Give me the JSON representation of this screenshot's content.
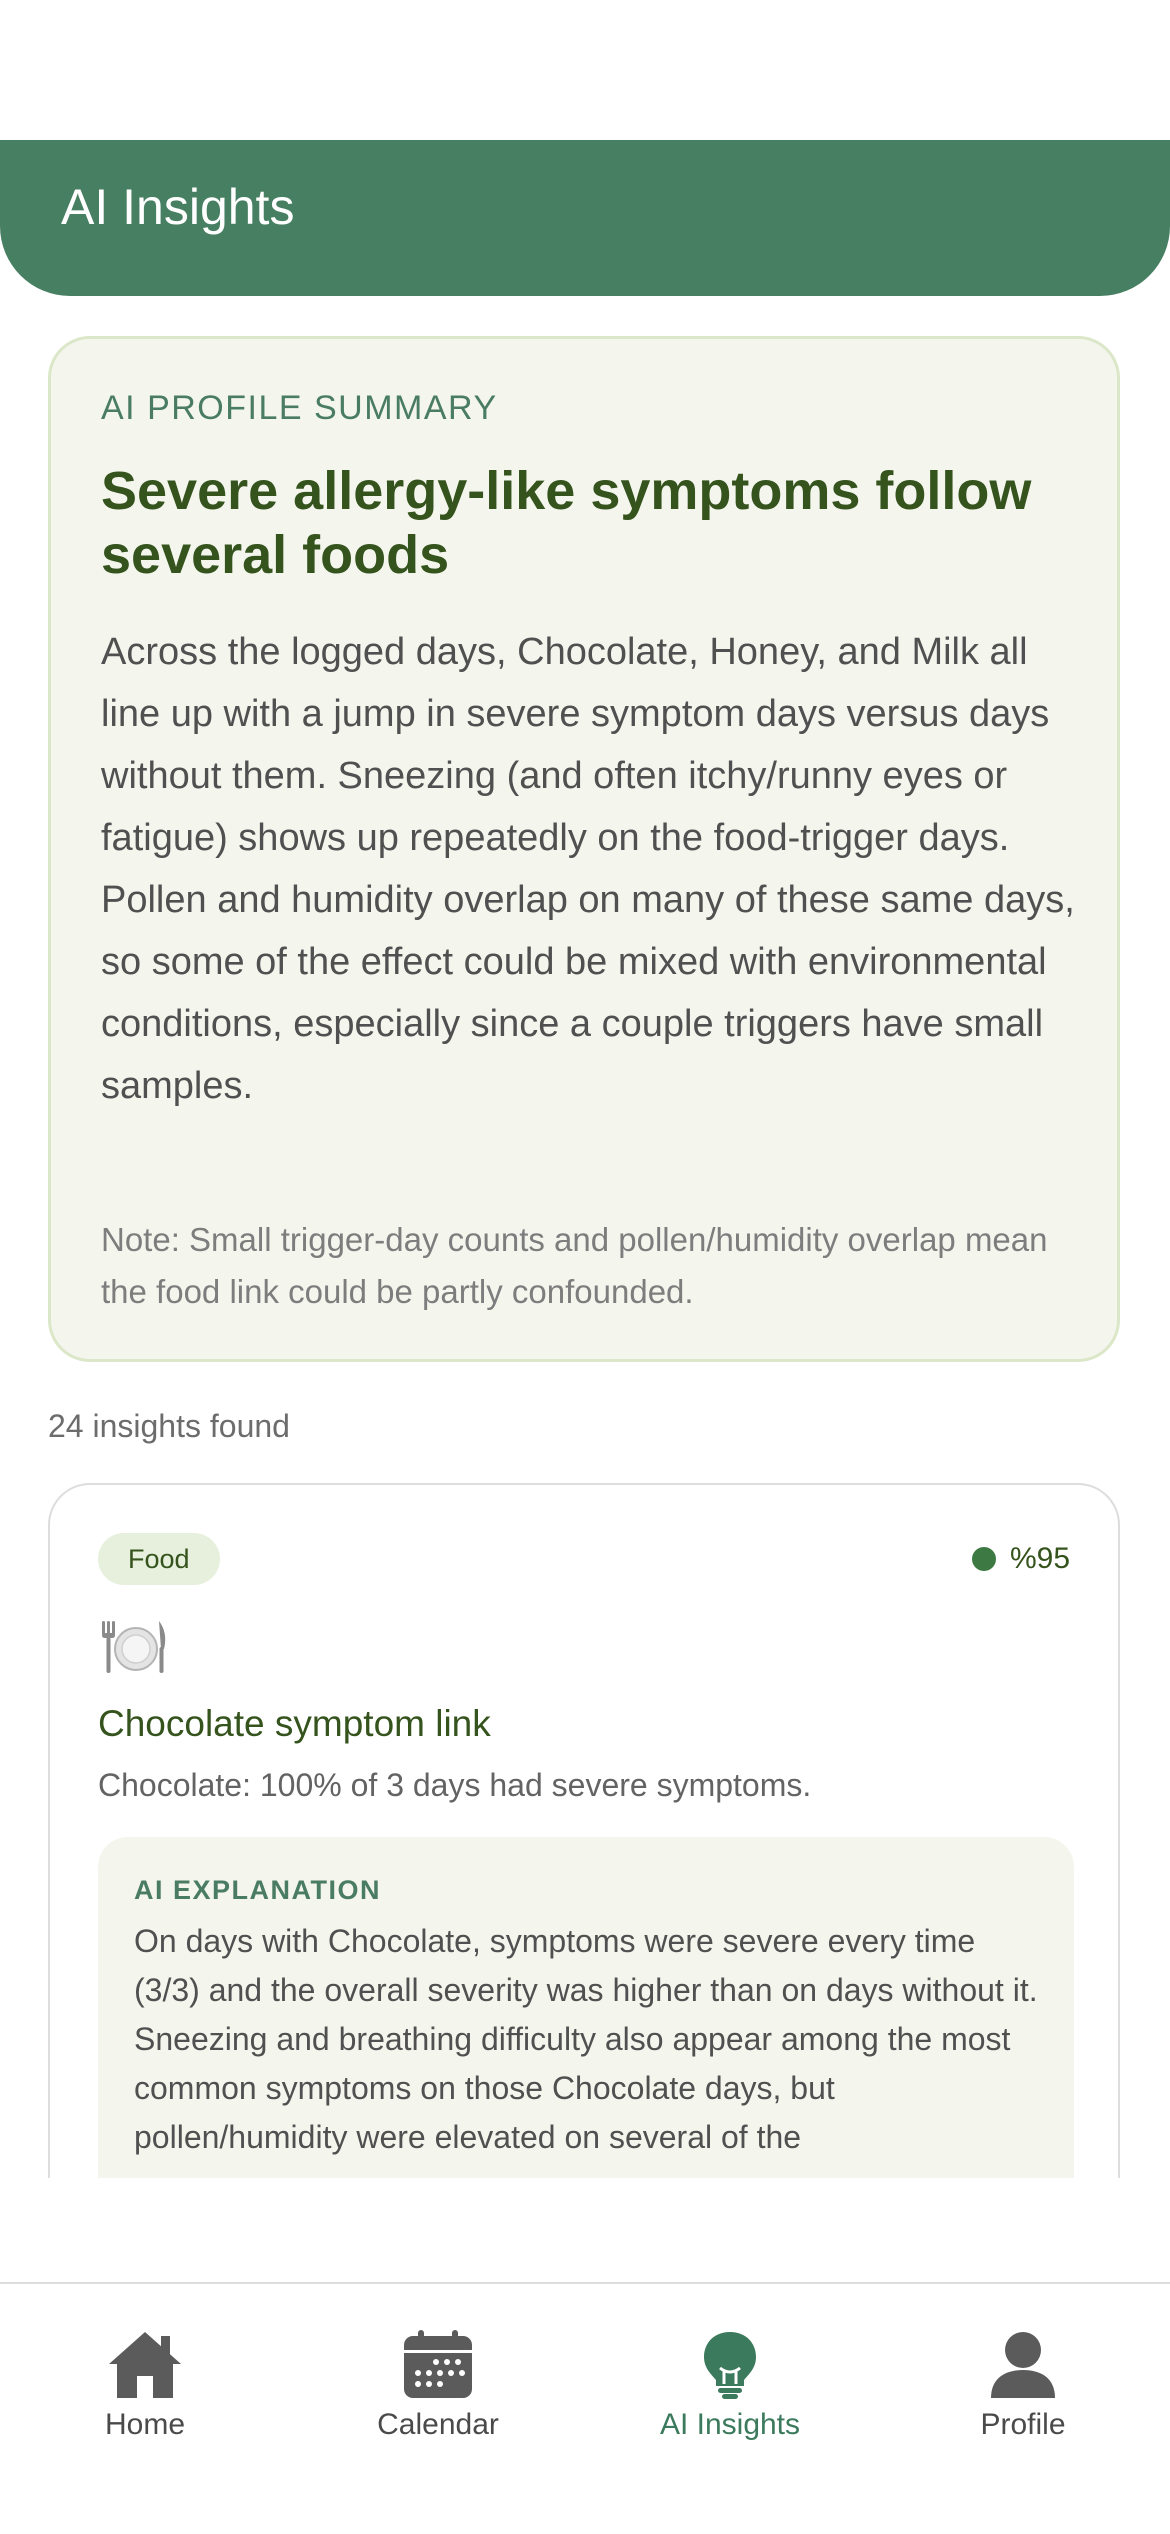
{
  "header": {
    "title": "AI Insights"
  },
  "summary": {
    "eyebrow": "AI PROFILE SUMMARY",
    "title": "Severe allergy-like symptoms follow several foods",
    "body": "Across the logged days, Chocolate, Honey, and Milk all line up with a jump in severe symptom days versus days without them. Sneezing (and often itchy/runny eyes or fatigue) shows up repeatedly on the food-trigger days. Pollen and humidity overlap on many of these same days, so some of the effect could be mixed with environmental conditions, especially since a couple triggers have small samples.",
    "note": "Note: Small trigger-day counts and pollen/humidity overlap mean the food link could be partly confounded."
  },
  "insights_count": "24 insights found",
  "insights": [
    {
      "category": "Food",
      "confidence": "%95",
      "icon": "plate-with-cutlery-icon",
      "title": "Chocolate symptom link",
      "summary": "Chocolate: 100% of 3 days had severe symptoms.",
      "explanation_label": "AI EXPLANATION",
      "explanation": "On days with Chocolate, symptoms were severe every time (3/3) and the overall severity was higher than on days without it. Sneezing and breathing difficulty also appear among the most common symptoms on those Chocolate days, but pollen/humidity were elevated on several of the"
    }
  ],
  "tabbar": {
    "items": [
      {
        "label": "Home",
        "icon": "home-icon",
        "active": false
      },
      {
        "label": "Calendar",
        "icon": "calendar-icon",
        "active": false
      },
      {
        "label": "AI Insights",
        "icon": "lightbulb-icon",
        "active": true
      },
      {
        "label": "Profile",
        "icon": "profile-icon",
        "active": false
      }
    ]
  },
  "colors": {
    "header_bg": "#477f62",
    "accent_dark_green": "#35531d",
    "card_bg": "#f4f6ee",
    "active_tab": "#3b7a5c",
    "inactive_tab": "#4a4a4a"
  }
}
